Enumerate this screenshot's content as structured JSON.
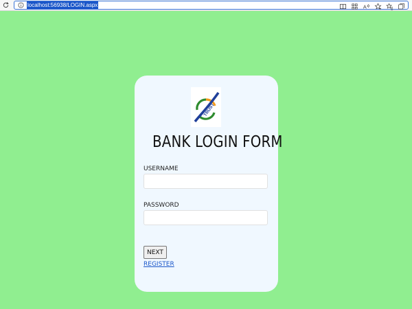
{
  "browser": {
    "url": "localhost:56938/LOGIN.aspx",
    "icons": [
      "reload-icon",
      "info-icon",
      "split-screen-icon",
      "app-grid-icon",
      "read-aloud-icon",
      "favorite-add-icon",
      "favorites-icon",
      "collections-icon"
    ]
  },
  "colors": {
    "page_background": "#90EE90",
    "card_background": "#F0F8FF",
    "link": "#1a56c9"
  },
  "login": {
    "logo_text": "TRUST",
    "title": "BANK LOGIN FORM",
    "username_label": "USERNAME",
    "username_value": "",
    "password_label": "PASSWORD",
    "password_value": "",
    "next_label": "NEXT",
    "register_label": "REGISTER"
  }
}
